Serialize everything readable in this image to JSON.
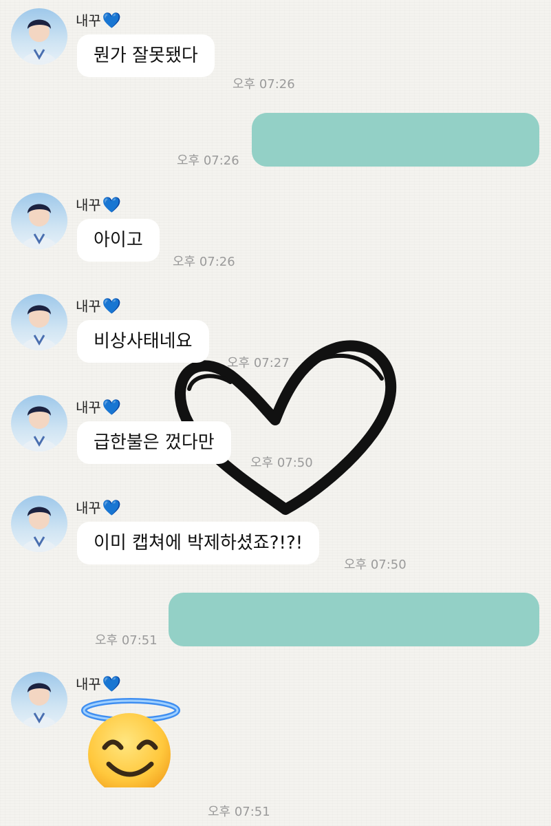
{
  "contact": {
    "name": "내꾸",
    "heart": "💙"
  },
  "colors": {
    "sent_bubble": "#93d0c6",
    "received_bubble": "#ffffff",
    "timestamp": "#9a9a9a"
  },
  "background_sticker": "heart-outline",
  "messages": [
    {
      "type": "received",
      "text": "뭔가 잘못됐다",
      "time": "오후 07:26"
    },
    {
      "type": "sent",
      "text": "",
      "time": "오후 07:26"
    },
    {
      "type": "received",
      "text": "아이고",
      "time": "오후 07:26"
    },
    {
      "type": "received",
      "text": "비상사태네요",
      "time": "오후 07:27"
    },
    {
      "type": "received",
      "text": "급한불은 껐다만",
      "time": "오후 07:50"
    },
    {
      "type": "received",
      "text": "이미 캡쳐에 박제하셨죠?!?!",
      "time": "오후 07:50"
    },
    {
      "type": "sent",
      "text": "",
      "time": "오후 07:51"
    },
    {
      "type": "received",
      "emoji": "smiling-face-with-halo",
      "time": "오후 07:51"
    }
  ]
}
